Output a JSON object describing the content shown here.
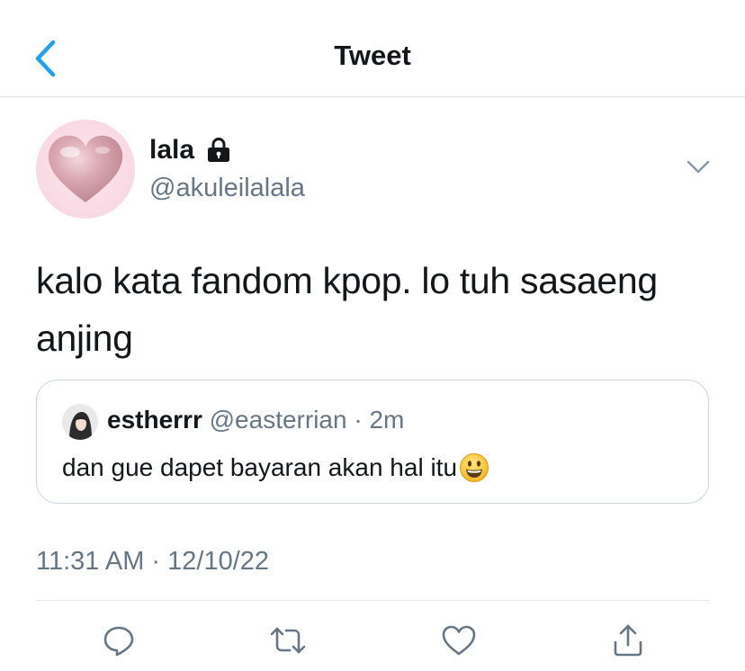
{
  "header": {
    "title": "Tweet",
    "back_icon": "chevron-left-icon",
    "accent_color": "#1da1f2"
  },
  "author": {
    "name": "lala",
    "handle": "@akuleilalala",
    "protected_icon": "lock-icon",
    "avatar": "pink-heart-avatar"
  },
  "tweet": {
    "text": "kalo kata fandom kpop. lo tuh sasaeng anjing",
    "timestamp": "11:31 AM · 12/10/22"
  },
  "quoted_tweet": {
    "name": "estherrr",
    "handle": "@easterrian",
    "separator": " · ",
    "time": "2m",
    "text": "dan gue dapet bayaran akan hal itu",
    "emoji_icon": "grinning-face-icon"
  },
  "actions": [
    {
      "icon": "reply-icon"
    },
    {
      "icon": "retweet-icon"
    },
    {
      "icon": "like-icon"
    },
    {
      "icon": "share-icon"
    }
  ],
  "colors": {
    "text_primary": "#14171a",
    "text_secondary": "#657786",
    "border": "#ccd6dd"
  }
}
